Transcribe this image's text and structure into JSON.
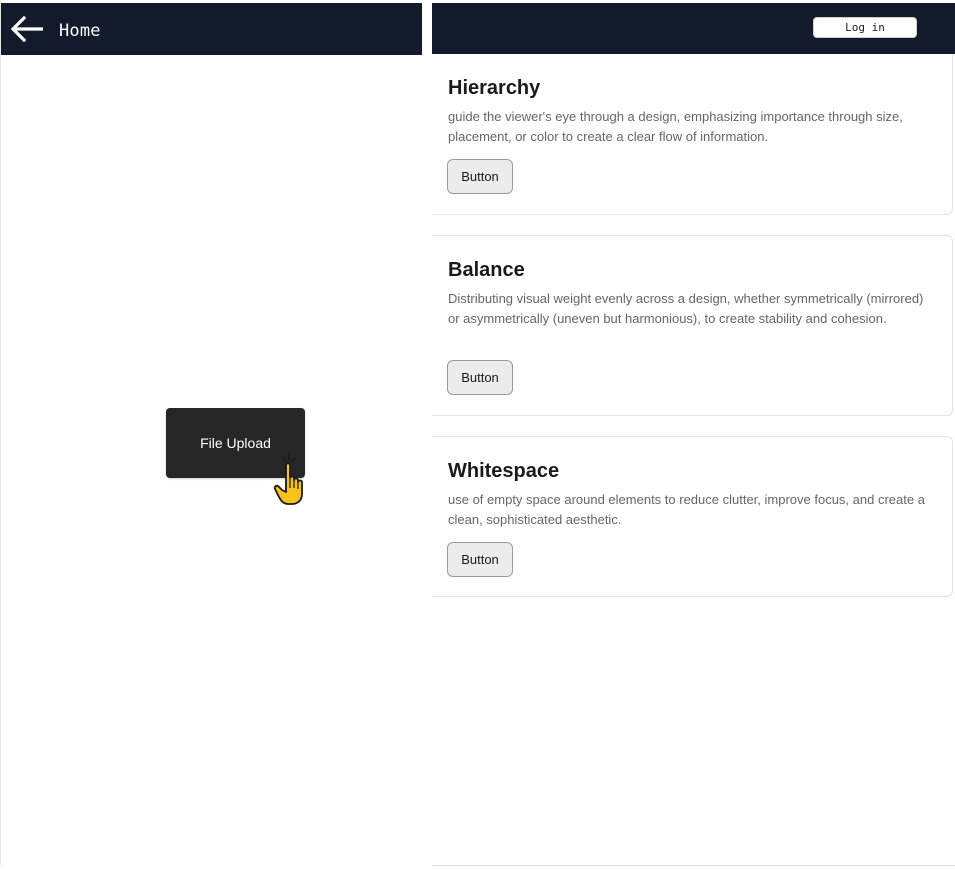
{
  "left": {
    "header": {
      "title": "Home",
      "back_icon": "arrow-left-icon",
      "background": "#131a2c"
    },
    "file_upload": {
      "label": "File Upload",
      "background": "#262626"
    },
    "cursor_icon": "hand-pointer-icon"
  },
  "right": {
    "header": {
      "login_label": "Log in",
      "background": "#131a2c"
    },
    "cards": [
      {
        "title": "Hierarchy",
        "description": "guide the viewer's eye through a design, emphasizing importance through size, placement, or color to create a clear flow of information.",
        "button_label": "Button"
      },
      {
        "title": "Balance",
        "description": "Distributing visual weight evenly across a design, whether symmetrically (mirrored) or asymmetrically (uneven but harmonious), to create stability and cohesion.",
        "button_label": "Button"
      },
      {
        "title": "Whitespace",
        "description": "use of empty space around elements to reduce clutter, improve focus, and create a clean, sophisticated aesthetic.",
        "button_label": "Button"
      }
    ]
  }
}
